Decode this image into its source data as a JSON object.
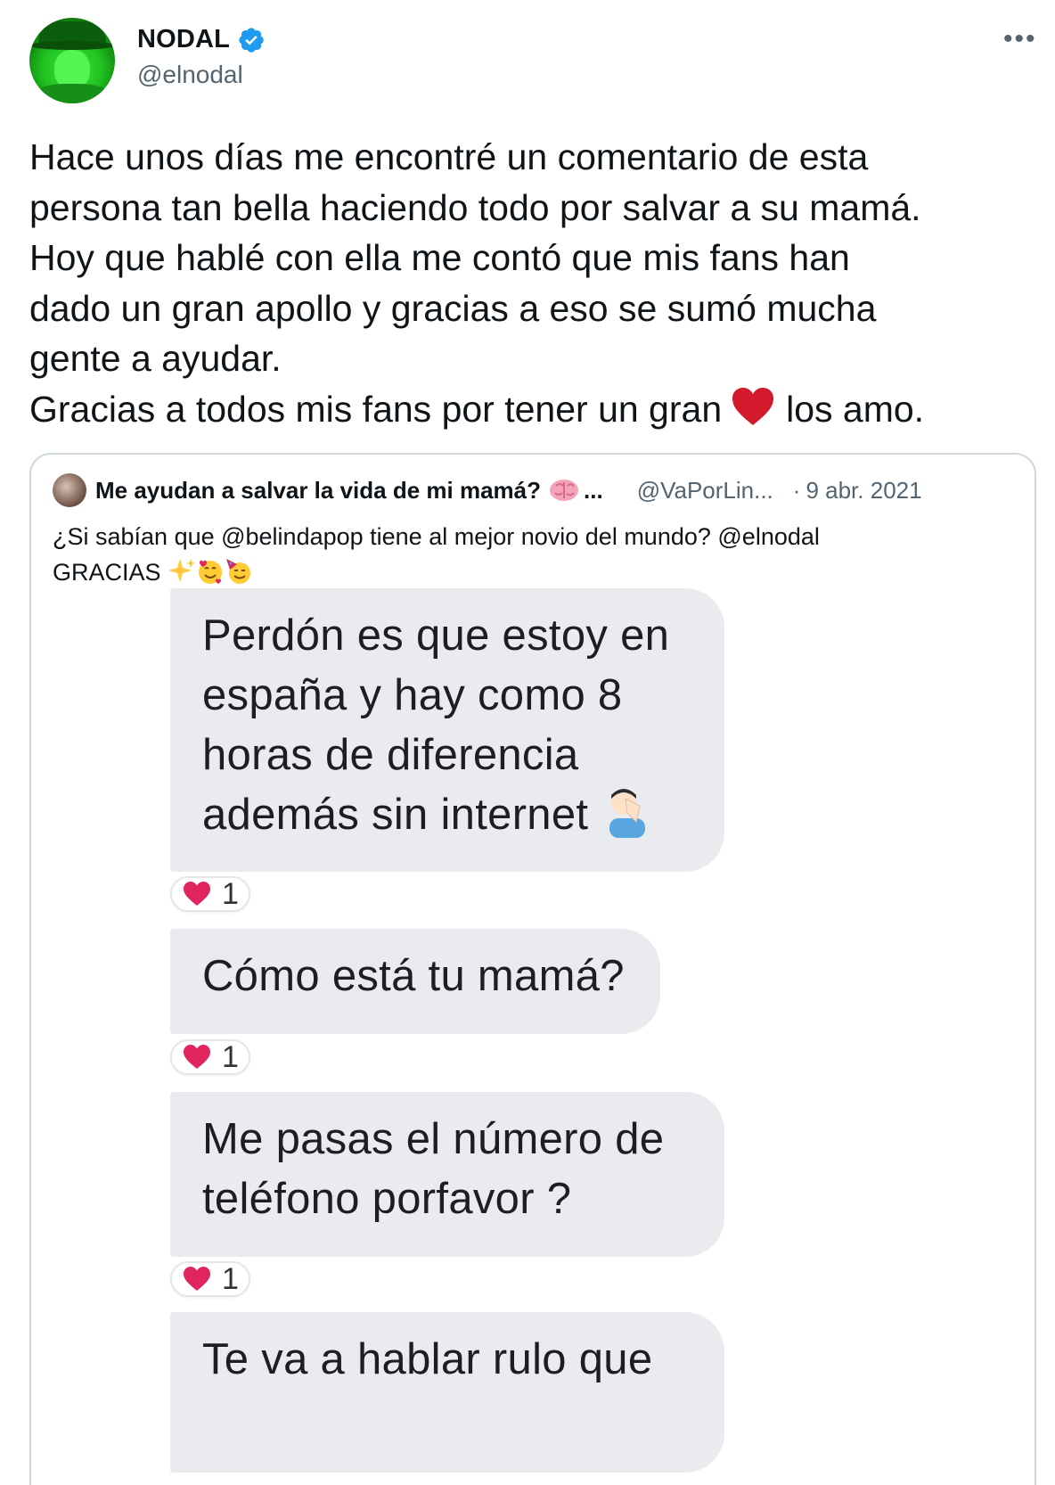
{
  "author": {
    "display_name": "NODAL",
    "handle": "@elnodal",
    "verified": true
  },
  "tweet": {
    "lines": [
      "Hace unos días me encontré un comentario de esta",
      "persona tan bella haciendo todo por salvar a su mamá.",
      "Hoy que hablé con ella me contó que mis fans han",
      "dado un gran apollo y gracias a eso se sumó mucha",
      "gente a ayudar."
    ],
    "last_line_before": "Gracias a todos mis fans por tener un gran",
    "last_line_after": "los amo.",
    "heart_color": "#d31a2c"
  },
  "quote": {
    "name": "Me ayudan a salvar la vida de mi mamá?",
    "ellipsis": "...",
    "handle": "@VaPorLin...",
    "dot": "·",
    "date": "9 abr. 2021",
    "text_line1": "¿Si sabían que @belindapop  tiene al mejor novio del mundo? @elnodal",
    "text_line2": "GRACIAS",
    "icons": [
      "brain-icon",
      "sparkle-icon",
      "smiling-face-hearts-icon",
      "party-face-icon"
    ]
  },
  "messages": [
    {
      "lines": [
        "Perdón es que estoy en",
        "españa y hay como 8",
        "horas de diferencia",
        "además sin internet"
      ],
      "emoji": "facepalm-icon",
      "reaction_count": "1"
    },
    {
      "lines": [
        "Cómo está tu mamá?"
      ],
      "reaction_count": "1"
    },
    {
      "lines": [
        "Me pasas el número de",
        "teléfono porfavor ?"
      ],
      "reaction_count": "1"
    },
    {
      "lines": [
        "Te va a hablar rulo que"
      ]
    }
  ],
  "colors": {
    "verified_blue": "#1d9bf0",
    "text_primary": "#0f1419",
    "text_secondary": "#536471",
    "bubble_bg": "#e9ebee",
    "reaction_heart": "#e0245e"
  }
}
